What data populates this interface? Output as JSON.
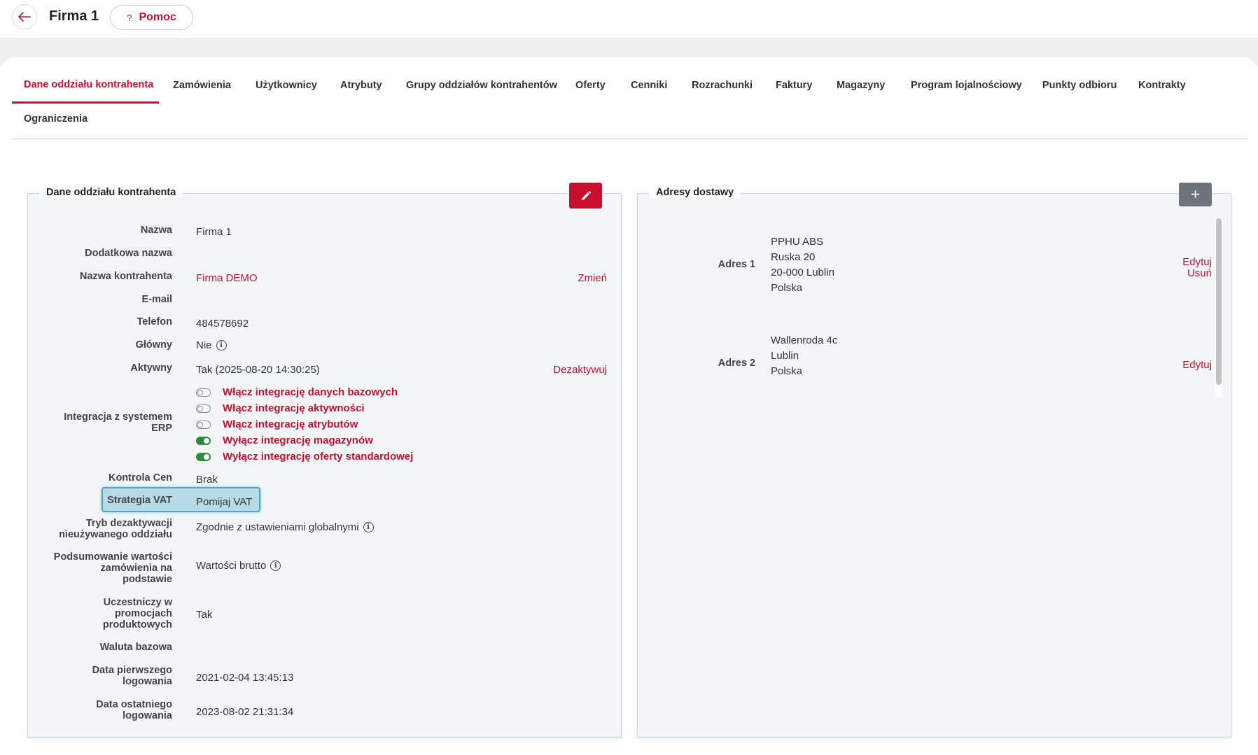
{
  "header": {
    "title": "Firma 1",
    "help_label": "Pomoc",
    "help_icon": "?"
  },
  "tabs": [
    "Dane oddziału kontrahenta",
    "Zamówienia",
    "Użytkownicy",
    "Atrybuty",
    "Grupy oddziałów kontrahentów",
    "Oferty",
    "Cenniki",
    "Rozrachunki",
    "Faktury",
    "Magazyny",
    "Program lojalnościowy",
    "Punkty odbioru",
    "Kontrakty",
    "Ograniczenia"
  ],
  "active_tab": "Dane oddziału kontrahenta",
  "details": {
    "title": "Dane oddziału kontrahenta",
    "nazwa_label": "Nazwa",
    "nazwa_value": "Firma 1",
    "dodatkowa_label": "Dodatkowa nazwa",
    "kontrahent_label": "Nazwa kontrahenta",
    "kontrahent_value": "Firma DEMO",
    "kontrahent_action": "Zmień",
    "email_label": "E-mail",
    "telefon_label": "Telefon",
    "telefon_value": "484578692",
    "glowny_label": "Główny",
    "glowny_value": "Nie",
    "aktywny_label": "Aktywny",
    "aktywny_value": "Tak (2025-08-20 14:30:25)",
    "aktywny_action": "Dezaktywuj",
    "erp_label_1": "Integracja z systemem",
    "erp_label_2": "ERP",
    "erp_toggles": [
      {
        "label": "Włącz integrację danych bazowych",
        "on": false
      },
      {
        "label": "Włącz integrację aktywności",
        "on": false
      },
      {
        "label": "Włącz integrację atrybutów",
        "on": false
      },
      {
        "label": "Wyłącz integrację magazynów",
        "on": true
      },
      {
        "label": "Wyłącz integrację oferty standardowej",
        "on": true
      }
    ],
    "kontrola_label": "Kontrola Cen",
    "kontrola_value": "Brak",
    "vat_label": "Strategia VAT",
    "vat_value": "Pomijaj VAT",
    "tryb_label_1": "Tryb dezaktywacji",
    "tryb_label_2": "nieużywanego oddziału",
    "tryb_value": "Zgodnie z ustawieniami globalnymi",
    "podsum_label_1": "Podsumowanie wartości",
    "podsum_label_2": "zamówienia na",
    "podsum_label_3": "podstawie",
    "podsum_value": "Wartości brutto",
    "promo_label_1": "Uczestniczy w",
    "promo_label_2": "promocjach",
    "promo_label_3": "produktowych",
    "promo_value": "Tak",
    "waluta_label": "Waluta bazowa",
    "first_login_label_1": "Data pierwszego",
    "first_login_label_2": "logowania",
    "first_login_value": "2021-02-04 13:45:13",
    "last_login_label_1": "Data ostatniego",
    "last_login_label_2": "logowania",
    "last_login_value": "2023-08-02 21:31:34"
  },
  "addresses": {
    "title": "Adresy dostawy",
    "add_label": "+",
    "items": [
      {
        "label": "Adres 1",
        "line1": "PPHU ABS",
        "line2": "Ruska 20",
        "line3": "20-000 Lublin",
        "line4": "Polska",
        "edit": "Edytuj",
        "delete": "Usuń"
      },
      {
        "label": "Adres 2",
        "line1": "Wallenroda 4c",
        "line2": "Lublin",
        "line3": "Polska",
        "edit": "Edytuj"
      }
    ]
  },
  "colors": {
    "accent": "#c8102e",
    "toggle_on": "#2e8b3d",
    "highlight": "#b7dbe6"
  }
}
